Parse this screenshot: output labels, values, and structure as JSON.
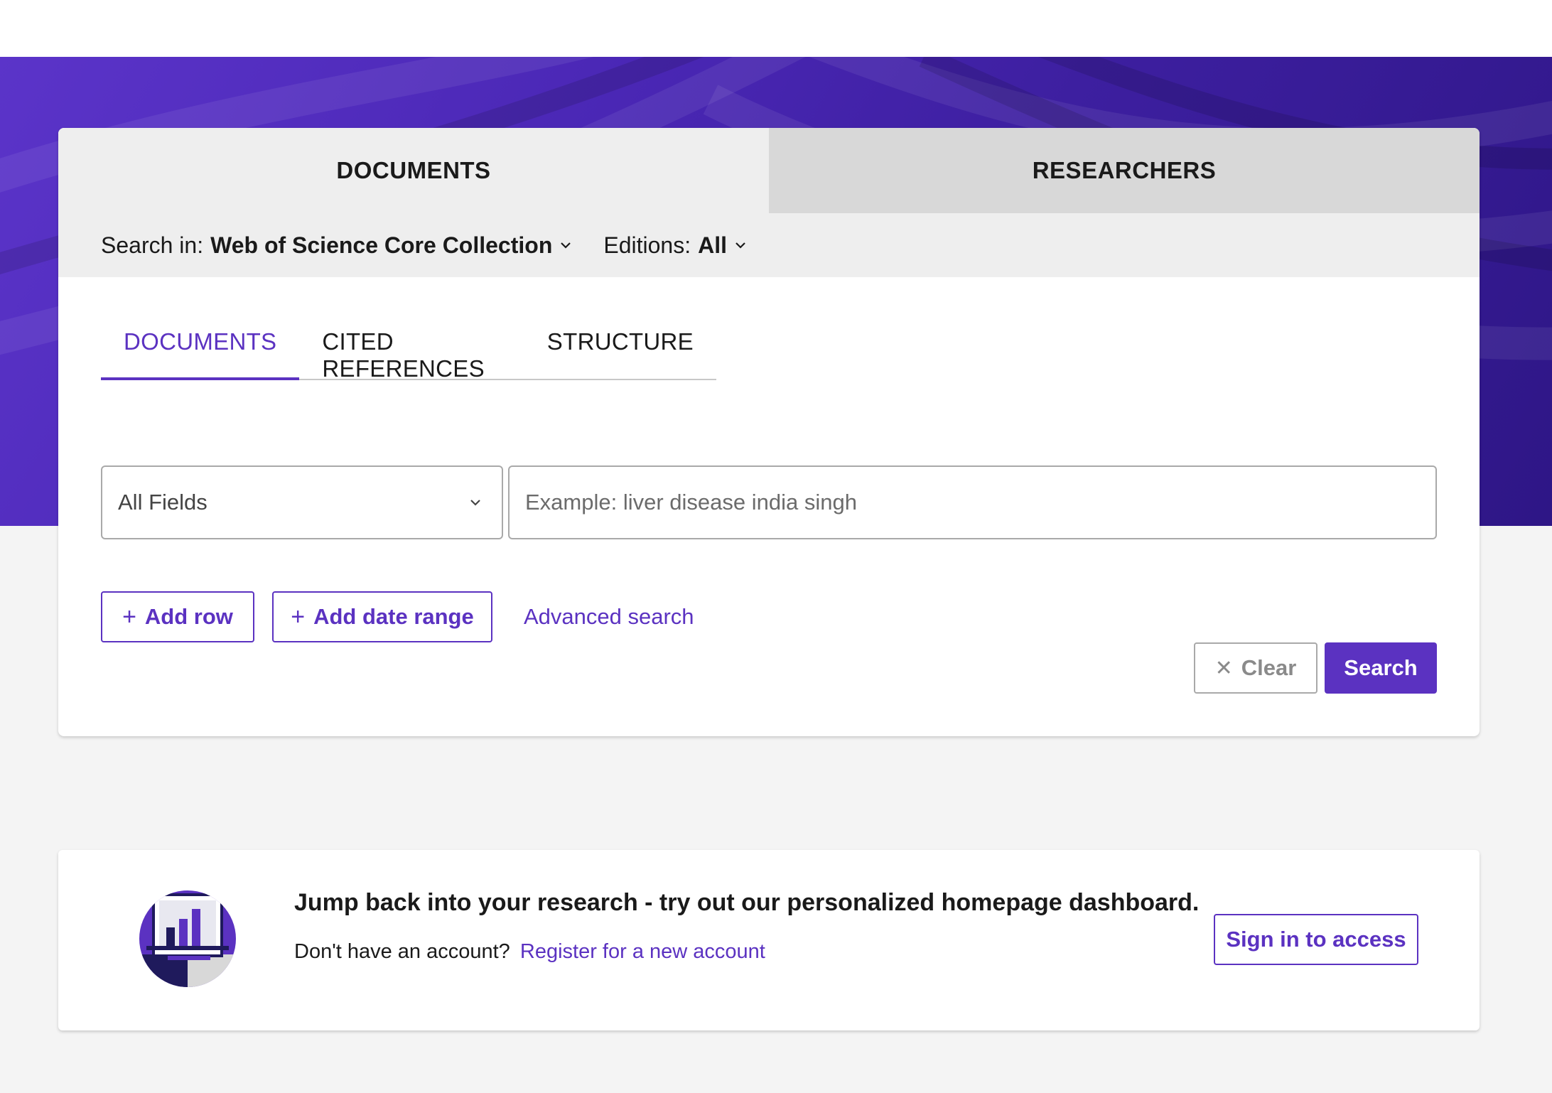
{
  "top_tabs": [
    {
      "label": "DOCUMENTS",
      "active": true
    },
    {
      "label": "RESEARCHERS",
      "active": false
    }
  ],
  "search_in": {
    "label": "Search in:",
    "value": "Web of Science Core Collection",
    "editions_label": "Editions:",
    "editions_value": "All"
  },
  "sub_tabs": [
    {
      "label": "DOCUMENTS",
      "active": true
    },
    {
      "label": "CITED REFERENCES",
      "active": false
    },
    {
      "label": "STRUCTURE",
      "active": false
    }
  ],
  "field_select": {
    "value": "All Fields"
  },
  "query": {
    "placeholder": "Example: liver disease india singh",
    "value": ""
  },
  "actions": {
    "add_row": "Add row",
    "add_date_range": "Add date range",
    "advanced_search": "Advanced search",
    "clear": "Clear",
    "search": "Search"
  },
  "promo": {
    "title": "Jump back into your research - try out our personalized homepage dashboard.",
    "subtitle": "Don't have an account?",
    "register_link": "Register for a new account",
    "sign_in": "Sign in to access"
  },
  "colors": {
    "accent": "#5b32c1",
    "hero": "#4a27b5",
    "page_bg": "#f4f4f4",
    "tab_inactive": "#d8d8d8",
    "tab_active": "#eeeeee"
  }
}
